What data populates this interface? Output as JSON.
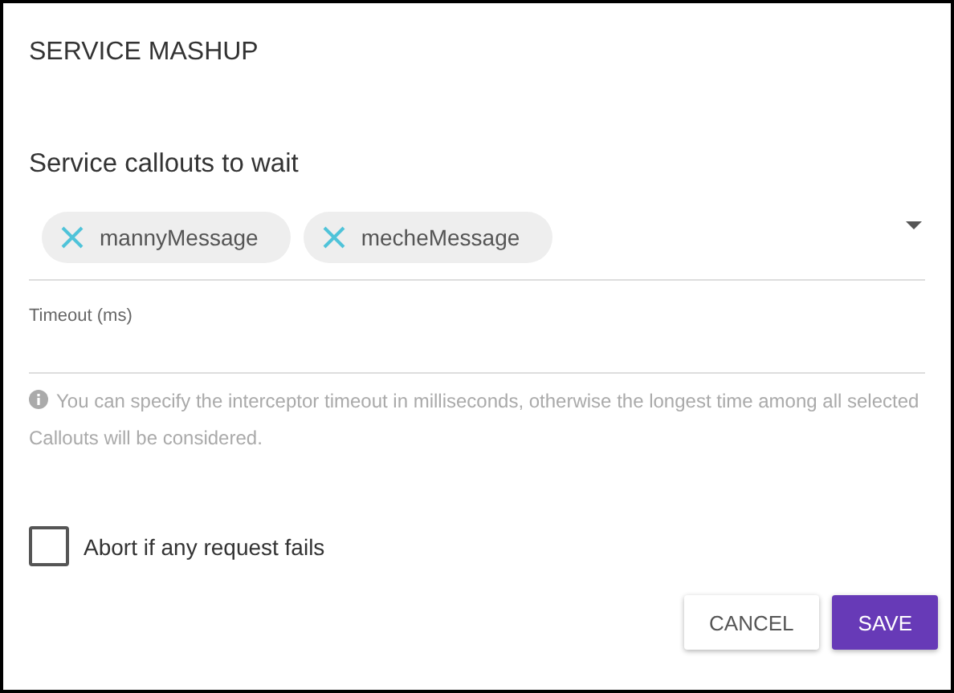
{
  "dialog": {
    "title": "SERVICE MASHUP"
  },
  "callouts": {
    "heading": "Service callouts to wait",
    "chips": [
      {
        "label": "mannyMessage"
      },
      {
        "label": "mecheMessage"
      }
    ]
  },
  "timeout": {
    "label": "Timeout (ms)",
    "help": "You can specify the interceptor timeout in milliseconds, otherwise the longest time among all selected Callouts will be considered."
  },
  "abort": {
    "label": "Abort if any request fails",
    "checked": false
  },
  "buttons": [
    {
      "label": "CANCEL",
      "kind": "secondary"
    },
    {
      "label": "SAVE",
      "kind": "primary"
    }
  ]
}
